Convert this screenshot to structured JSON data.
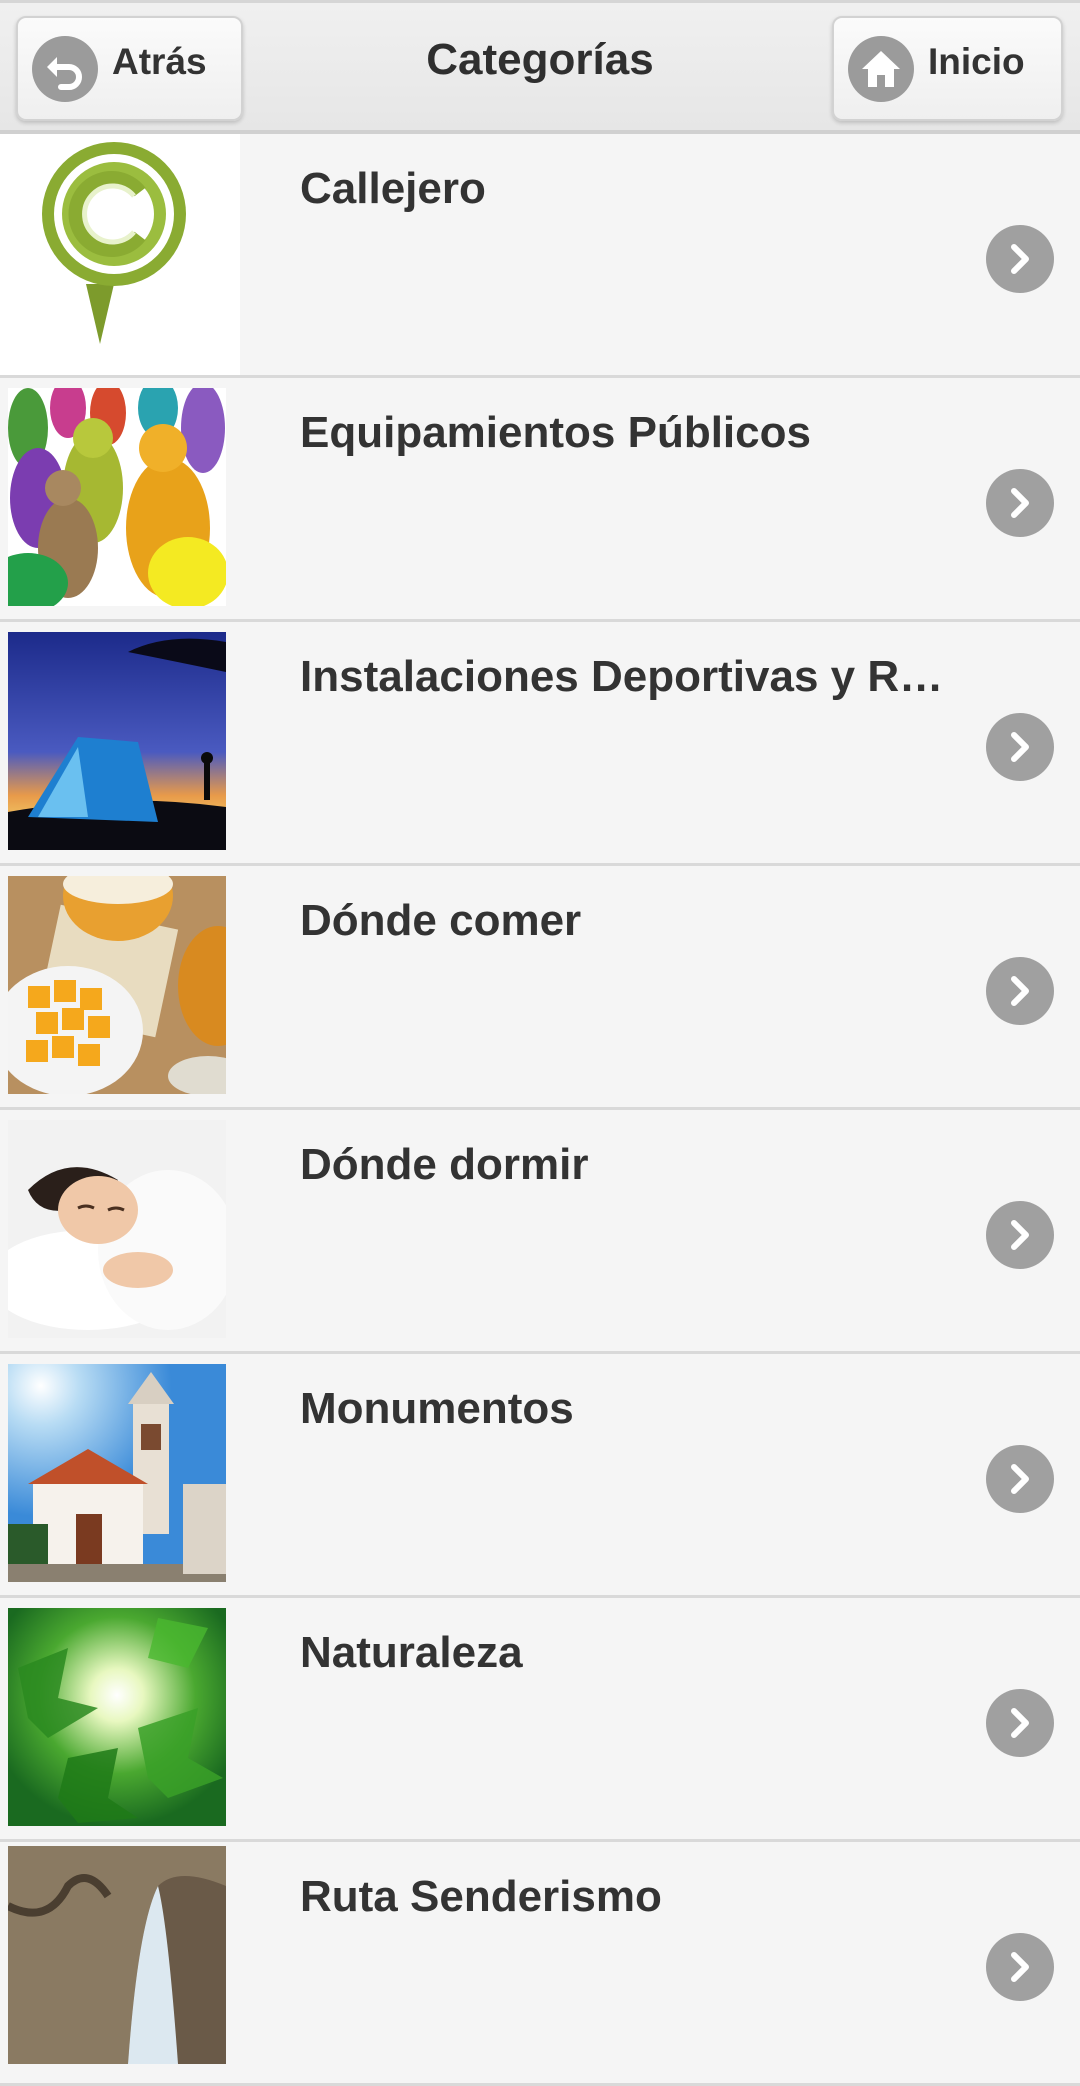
{
  "header": {
    "title": "Categorías",
    "back_label": "Atrás",
    "home_label": "Inicio"
  },
  "categories": [
    {
      "label": "Callejero",
      "icon": "callejero-pin-icon"
    },
    {
      "label": "Equipamientos Públicos",
      "icon": "people-group-image"
    },
    {
      "label": "Instalaciones Deportivas y R…",
      "icon": "tent-sunset-image"
    },
    {
      "label": "Dónde comer",
      "icon": "beer-cheese-image"
    },
    {
      "label": "Dónde dormir",
      "icon": "sleeping-woman-image"
    },
    {
      "label": "Monumentos",
      "icon": "church-tower-image"
    },
    {
      "label": "Naturaleza",
      "icon": "green-leaves-image"
    },
    {
      "label": "Ruta Senderismo",
      "icon": "rock-cave-image"
    }
  ],
  "colors": {
    "accent_green": "#8aab32",
    "chevron_gray": "#a0a0a0",
    "text": "#333333"
  }
}
